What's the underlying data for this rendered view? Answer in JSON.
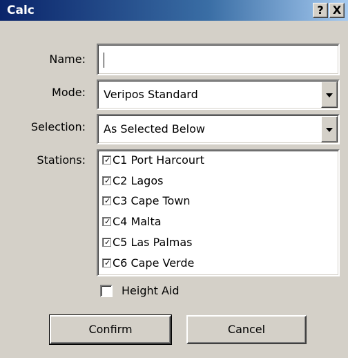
{
  "window": {
    "title": "Calc",
    "help_label": "?",
    "close_label": "X"
  },
  "form": {
    "name_label": "Name:",
    "name_value": "",
    "mode_label": "Mode:",
    "mode_value": "Veripos Standard",
    "selection_label": "Selection:",
    "selection_value": "As Selected Below",
    "stations_label": "Stations:",
    "stations": [
      {
        "label": "C1 Port Harcourt",
        "checked": true
      },
      {
        "label": "C2 Lagos",
        "checked": true
      },
      {
        "label": "C3 Cape Town",
        "checked": true
      },
      {
        "label": "C4 Malta",
        "checked": true
      },
      {
        "label": "C5 Las Palmas",
        "checked": true
      },
      {
        "label": "C6 Cape Verde",
        "checked": true
      }
    ],
    "height_aid_label": "Height Aid",
    "height_aid_checked": false
  },
  "buttons": {
    "confirm_label": "Confirm",
    "cancel_label": "Cancel"
  },
  "colors": {
    "titlebar_start": "#0a246a",
    "titlebar_end": "#a6caf0",
    "dialog_bg": "#d4d0c8"
  },
  "icons": {
    "check": "checkmark-icon",
    "dropdown": "chevron-down-icon"
  }
}
